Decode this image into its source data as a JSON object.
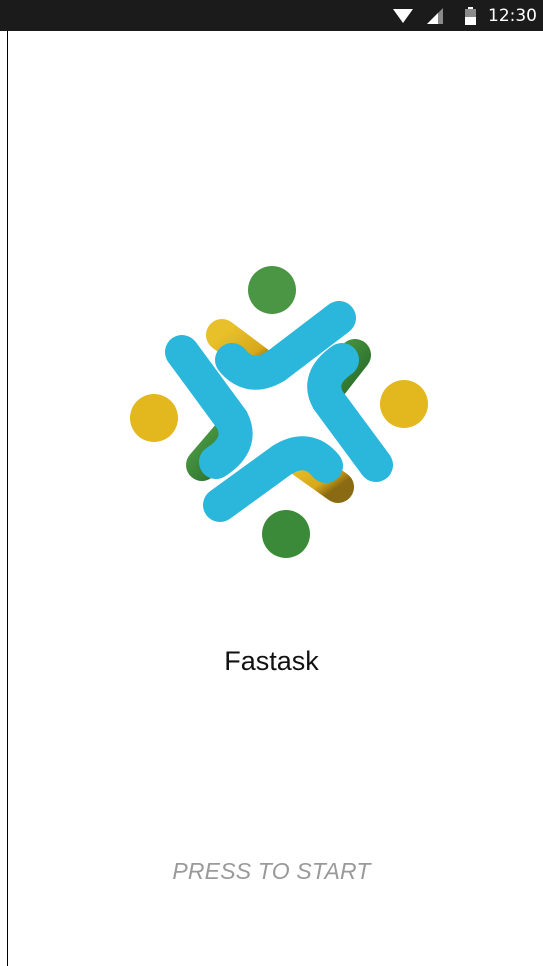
{
  "status_bar": {
    "time": "12:30",
    "icons": [
      "wifi-icon",
      "cell-signal-icon",
      "battery-icon"
    ]
  },
  "app": {
    "name": "Fastask",
    "logo_icon": "fastask-logo",
    "start_prompt": "PRESS TO START"
  },
  "colors": {
    "status_bar_bg": "#1b1b1b",
    "background": "#ffffff",
    "logo_blue": "#2bb6dc",
    "logo_green": "#3d8f3b",
    "logo_yellow": "#e3b81f",
    "prompt_text": "#9a9a9a"
  }
}
